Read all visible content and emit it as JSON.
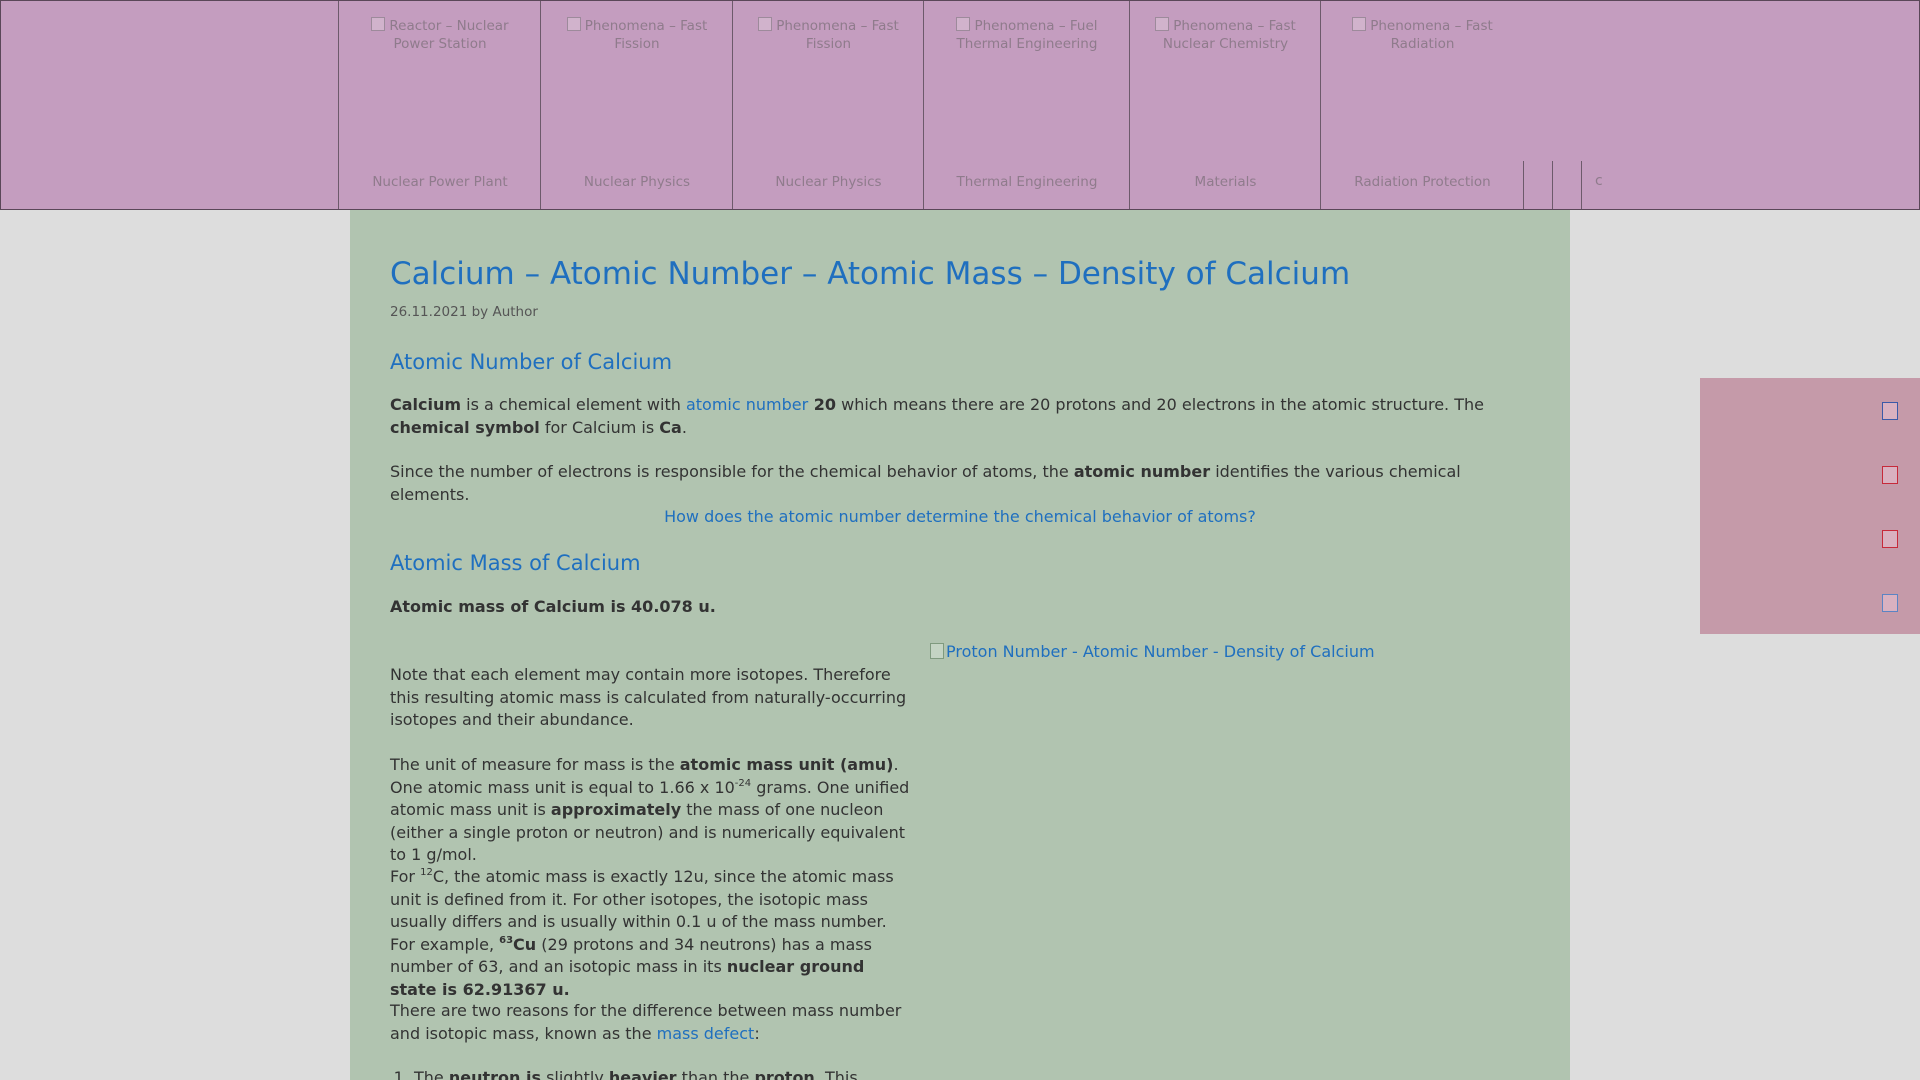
{
  "nav": {
    "items": [
      {
        "img_alt": "Reactor – Nuclear Power Station",
        "label": "Nuclear Power Plant"
      },
      {
        "img_alt": "Phenomena – Fast Fission",
        "label": "Nuclear Physics"
      },
      {
        "img_alt": "Phenomena – Fast Fission",
        "label": "Nuclear Physics"
      },
      {
        "img_alt": "Phenomena – Fuel Thermal Engineering",
        "label": "Thermal Engineering"
      },
      {
        "img_alt": "Phenomena – Fast Nuclear Chemistry",
        "label": "Materials"
      },
      {
        "img_alt": "Phenomena – Fast Radiation",
        "label": "Radiation Protection"
      }
    ],
    "last_char": "c"
  },
  "article": {
    "title": "Calcium – Atomic Number – Atomic Mass – Density of Calcium",
    "meta": {
      "date": "26.11.2021",
      "by": "by",
      "author": "Author"
    },
    "sec1_heading": "Atomic Number of Calcium",
    "p1": {
      "element": "Calcium",
      "t1": " is a chemical element with ",
      "link": "atomic number",
      "number": " 20",
      "t2": " which means there are 20 protons and 20 electrons in the atomic structure. The ",
      "chem_symbol": "chemical symbol",
      "t3": " for Calcium is ",
      "symbol": "Ca",
      "t4": "."
    },
    "p2": {
      "t1": "Since the number of electrons is responsible for the chemical behavior of atoms, the ",
      "bold": "atomic number",
      "t2": " identifies the various chemical elements."
    },
    "center_link": "How does the atomic number determine the chemical behavior of atoms?",
    "sec2_heading": "Atomic Mass of Calcium",
    "mass_statement": "Atomic mass of Calcium is 40.078 u.",
    "figure_alt": "Proton Number - Atomic Number - Density of Calcium",
    "p3": "Note that each element may contain more isotopes. Therefore this resulting atomic mass is calculated from naturally-occurring isotopes and their abundance.",
    "p4": {
      "t1": "The unit of measure for mass is the ",
      "bold1": "atomic mass unit (amu)",
      "t2": ". One atomic mass unit is equal to 1.66 x 10",
      "sup": "-24",
      "t3": " grams. One unified atomic mass unit is ",
      "bold2": "approximately",
      "t4": " the mass of one nucleon (either a single proton or neutron) and is numerically equivalent to 1 g/mol."
    },
    "p5": {
      "t1": "For ",
      "sup1": "12",
      "t2": "C, the atomic mass is exactly 12u, since the atomic mass unit is defined from it. For other isotopes, the isotopic mass usually differs and is usually within 0.1 u of the mass number. For example, ",
      "sup2": "63",
      "cu": "Cu",
      "t3": " (29 protons and 34 neutrons) has a mass number of 63, and an isotopic mass in its ",
      "bold": "nuclear ground state is 62.91367 u."
    },
    "p6": {
      "t1": "There are two reasons for the difference between mass number and isotopic mass, known as the ",
      "link": "mass defect",
      "t2": ":"
    },
    "list_item1": {
      "t1": "The ",
      "b1": "neutron is",
      "t2": " slightly ",
      "b2": "heavier",
      "t3": " than the ",
      "b3": "proton",
      "t4": ". This"
    }
  },
  "share": [
    "facebook-icon",
    "pinterest-icon",
    "youtube-icon",
    "twitter-icon"
  ],
  "colors": {
    "nav_bg": "#c49dbf",
    "article_bg": "#b1c4b0",
    "page_bg": "#dddddd",
    "link": "#1f6fbf",
    "share_bg": "#c59aa9"
  }
}
